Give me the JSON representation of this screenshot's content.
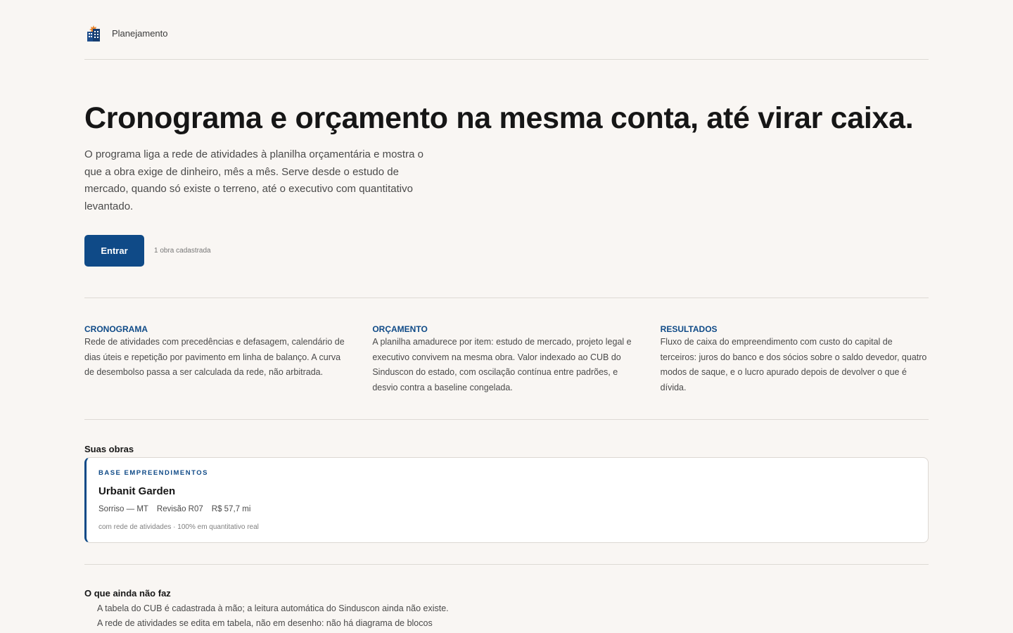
{
  "header": {
    "brand": "Planejamento"
  },
  "hero": {
    "title": "Cronograma e orçamento na mesma conta, até virar caixa.",
    "description": "O programa liga a rede de atividades à planilha orçamentária e mostra o que a obra exige de dinheiro, mês a mês. Serve desde o estudo de mercado, quando só existe o terreno, até o executivo com quantitativo levantado.",
    "cta_label": "Entrar",
    "cta_note": "1 obra cadastrada"
  },
  "features": [
    {
      "title": "CRONOGRAMA",
      "text": "Rede de atividades com precedências e defasagem, calendário de dias úteis e repetição por pavimento em linha de balanço. A curva de desembolso passa a ser calculada da rede, não arbitrada."
    },
    {
      "title": "ORÇAMENTO",
      "text": "A planilha amadurece por item: estudo de mercado, projeto legal e executivo convivem na mesma obra. Valor indexado ao CUB do Sinduscon do estado, com oscilação contínua entre padrões, e desvio contra a baseline congelada."
    },
    {
      "title": "RESULTADOS",
      "text": "Fluxo de caixa do empreendimento com custo do capital de terceiros: juros do banco e dos sócios sobre o saldo devedor, quatro modos de saque, e o lucro apurado depois de devolver o que é dívida."
    }
  ],
  "obras": {
    "title": "Suas obras",
    "items": [
      {
        "company": "BASE EMPREENDIMENTOS",
        "name": "Urbanit Garden",
        "location": "Sorriso — MT",
        "revision": "Revisão R07",
        "value": "R$ 57,7 mi",
        "footnote": "com rede de atividades · 100% em quantitativo real"
      }
    ]
  },
  "limits": {
    "title": "O que ainda não faz",
    "items": [
      "A tabela do CUB é cadastrada à mão; a leitura automática do Sinduscon ainda não existe.",
      "A rede de atividades se edita em tabela, não em desenho: não há diagrama de blocos"
    ]
  },
  "colors": {
    "accent": "#0f4a87",
    "background": "#f9f6f3",
    "logo_orange": "#e8842c"
  },
  "icons": {
    "logo": "building-logo-icon"
  }
}
